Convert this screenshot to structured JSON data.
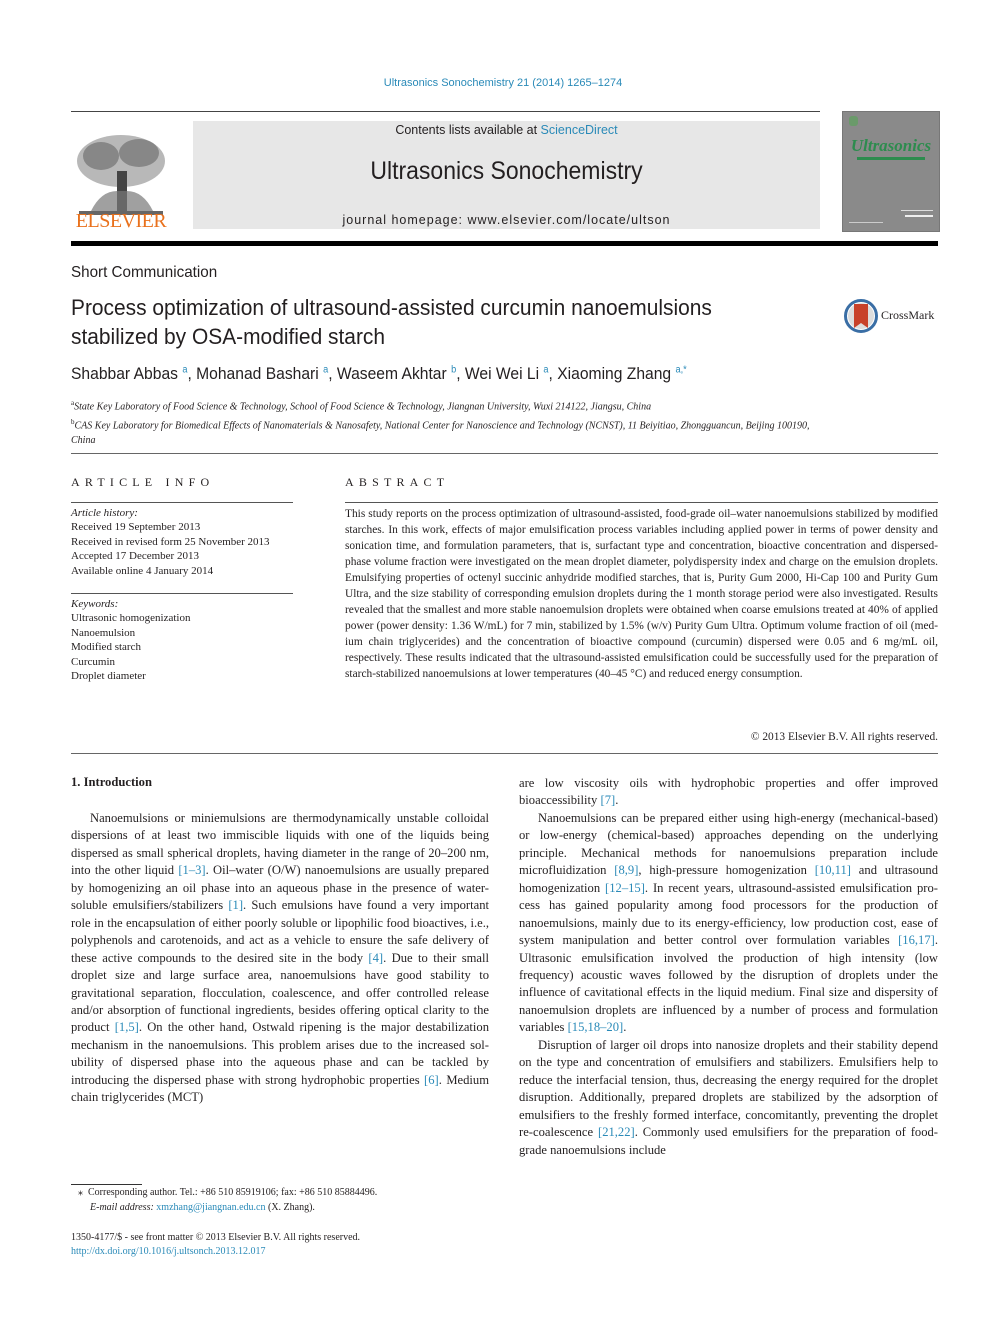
{
  "header": {
    "citation": "Ultrasonics Sonochemistry 21 (2014) 1265–1274",
    "contents_prefix": "Contents lists available at ",
    "contents_link": "ScienceDirect",
    "journal_title": "Ultrasonics Sonochemistry",
    "homepage": "journal homepage: www.elsevier.com/locate/ultson",
    "publisher_logo": "ELSEVIER",
    "cover_title": "Ultrasonics",
    "crossmark_label": "CrossMark"
  },
  "article": {
    "type": "Short Communication",
    "title_line1": "Process optimization of ultrasound-assisted curcumin nanoemulsions",
    "title_line2": "stabilized by OSA-modified starch",
    "authors": [
      {
        "name": "Shabbar Abbas",
        "sup": "a"
      },
      {
        "name": "Mohanad Bashari",
        "sup": "a"
      },
      {
        "name": "Waseem Akhtar",
        "sup": "b"
      },
      {
        "name": "Wei Wei Li",
        "sup": "a"
      },
      {
        "name": "Xiaoming Zhang",
        "sup": "a,*"
      }
    ],
    "affiliations": [
      {
        "sup": "a",
        "text": "State Key Laboratory of Food Science & Technology, School of Food Science & Technology, Jiangnan University, Wuxi 214122, Jiangsu, China"
      },
      {
        "sup": "b",
        "text": "CAS Key Laboratory for Biomedical Effects of Nanomaterials & Nanosafety, National Center for Nanoscience and Technology (NCNST), 11 Beiyitiao, Zhongguancun, Beijing 100190, China"
      }
    ]
  },
  "article_info": {
    "heading": "ARTICLE INFO",
    "history_label": "Article history:",
    "history": [
      "Received 19 September 2013",
      "Received in revised form 25 November 2013",
      "Accepted 17 December 2013",
      "Available online 4 January 2014"
    ],
    "keywords_label": "Keywords:",
    "keywords": [
      "Ultrasonic homogenization",
      "Nanoemulsion",
      "Modified starch",
      "Curcumin",
      "Droplet diameter"
    ]
  },
  "abstract": {
    "heading": "ABSTRACT",
    "text": "This study reports on the process optimization of ultrasound-assisted, food-grade oil–water nanoemul­sions stabilized by modified starches. In this work, effects of major emulsification process variables including applied power in terms of power density and sonication time, and formulation parameters, that is, surfactant type and concentration, bioactive concentration and dispersed-phase volume fraction were investigated on the mean droplet diameter, polydispersity index and charge on the emulsion droplets. Emulsifying properties of octenyl succinic anhydride modified starches, that is, Purity Gum 2000, Hi-Cap 100 and Purity Gum Ultra, and the size stability of corresponding emulsion droplets during the 1 month storage period were also investigated. Results revealed that the smallest and more stable nano­emulsion droplets were obtained when coarse emulsions treated at 40% of applied power (power density: 1.36 W/mL) for 7 min, stabilized by 1.5% (w/v) Purity Gum Ultra. Optimum volume fraction of oil (med­ium chain triglycerides) and the concentration of bioactive compound (curcumin) dispersed were 0.05 and 6 mg/mL oil, respectively. These results indicated that the ultrasound-assisted emulsification could be successfully used for the preparation of starch-stabilized nanoemulsions at lower temperatures (40–45 °C) and reduced energy consumption.",
    "copyright": "© 2013 Elsevier B.V. All rights reserved."
  },
  "body": {
    "intro_heading": "1. Introduction",
    "col1_p1": [
      {
        "t": "Nanoemulsions or miniemulsions are thermodynamically unstable colloidal dispersions of at least two immiscible liquids with one of the liquids being dispersed as small spherical droplets, having diameter in the range of 20–200 nm, into the other liquid "
      },
      {
        "ref": "[1–3]"
      },
      {
        "t": ". Oil–water (O/W) nanoemulsions are usually prepared by homogenizing an oil phase into an aqueous phase in the presence of water-soluble emulsifiers/stabilizers "
      },
      {
        "ref": "[1]"
      },
      {
        "t": ". Such emulsions have found a very important role in the encapsulation of either poorly soluble or lipophilic food bioactives, i.e., polyphenols and carote­noids, and act as a vehicle to ensure the safe delivery of these active compounds to the desired site in the body "
      },
      {
        "ref": "[4]"
      },
      {
        "t": ". Due to their small droplet size and large surface area, nanoemulsions have good stability to gravitational separation, flocculation, coalescence, and offer controlled release and/or absorption of functional ingredients, besides offering optical clarity to the product "
      },
      {
        "ref": "[1,5]"
      },
      {
        "t": ". On the other hand, Ostwald ripening is the major destabilization mechanism in the nanoemulsions. This problem arises due to the increased sol­ubility of dispersed phase into the aqueous phase and can be tackled by introducing the dispersed phase with strong hydrophobic properties "
      },
      {
        "ref": "[6]"
      },
      {
        "t": ". Medium chain triglycerides (MCT)"
      }
    ],
    "col2_p1": [
      {
        "t": "are low viscosity oils with hydrophobic properties and offer im­proved bioaccessibility "
      },
      {
        "ref": "[7]"
      },
      {
        "t": "."
      }
    ],
    "col2_p2": [
      {
        "t": "Nanoemulsions can be prepared either using high-energy (mechanical-based) or low-energy (chemical-based) approaches depending on the underlying principle. Mechanical methods for nanoemulsions preparation include microfluidization "
      },
      {
        "ref": "[8,9]"
      },
      {
        "t": ", high-pressure homogenization "
      },
      {
        "ref": "[10,11]"
      },
      {
        "t": " and ultrasound homogenization "
      },
      {
        "ref": "[12–15]"
      },
      {
        "t": ". In recent years, ultrasound-assisted emulsification pro­cess has gained popularity among food processors for the produc­tion of nanoemulsions, mainly due to its energy-efficiency, low production cost, ease of system manipulation and better control over formulation variables "
      },
      {
        "ref": "[16,17]"
      },
      {
        "t": ". Ultrasonic emulsification in­volved the production of high intensity (low frequency) acoustic waves followed by the disruption of droplets under the influence of cavitational effects in the liquid medium. Final size and disper­sity of nanoemulsion droplets are influenced by a number of process and formulation variables "
      },
      {
        "ref": "[15,18–20]"
      },
      {
        "t": "."
      }
    ],
    "col2_p3": [
      {
        "t": "Disruption of larger oil drops into nanosize droplets and their stability depend on the type and concentration of emulsifiers and stabilizers. Emulsifiers help to reduce the interfacial tension, thus, decreasing the energy required for the droplet disruption. Addi­tionally, prepared droplets are stabilized by the adsorption of emulsifiers to the freshly formed interface, concomitantly, pre­venting the droplet re-coalescence "
      },
      {
        "ref": "[21,22]"
      },
      {
        "t": ". Commonly used emul­sifiers for the preparation of food-grade nanoemulsions include"
      }
    ]
  },
  "footnote": {
    "marker": "⁎",
    "corresponding": "Corresponding author. Tel.: +86 510 85919106; fax: +86 510 85884496.",
    "email_label": "E-mail address:",
    "email": "xmzhang@jiangnan.edu.cn",
    "email_suffix": " (X. Zhang)."
  },
  "front_matter": {
    "issn": "1350-4177/$ - see front matter © 2013 Elsevier B.V. All rights reserved.",
    "doi": "http://dx.doi.org/10.1016/j.ultsonch.2013.12.017"
  },
  "colors": {
    "link": "#2a8ab8",
    "elsevier_orange": "#e9711c",
    "banner_gray": "#e7e7e7",
    "cover_gray": "#8a8a8a",
    "cover_green": "#2d8c4e"
  }
}
